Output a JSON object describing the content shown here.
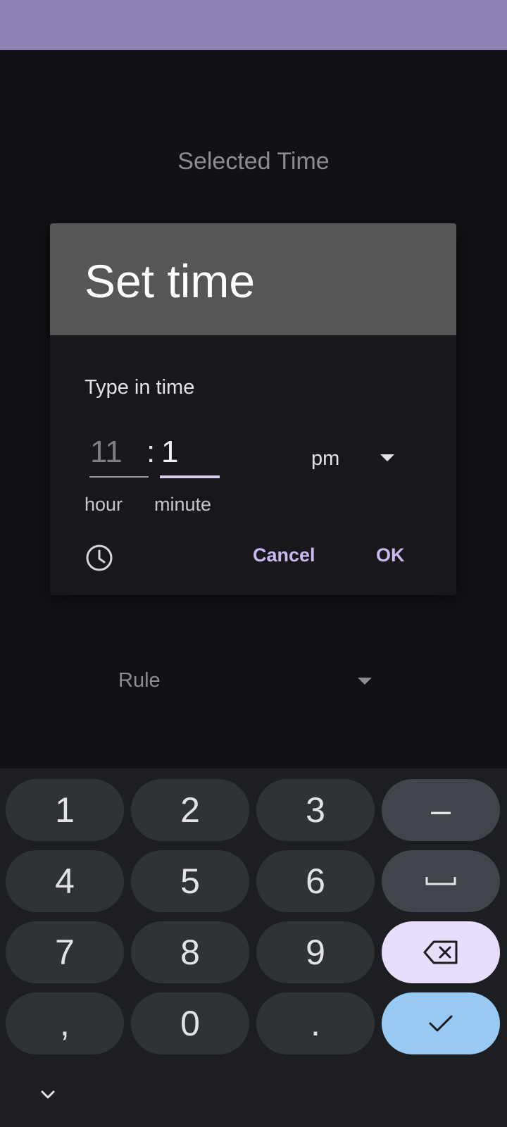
{
  "app": {
    "selected_time_label": "Selected Time",
    "rule_label": "Rule"
  },
  "dialog": {
    "title": "Set time",
    "subtitle": "Type in time",
    "hour_value": "11",
    "separator": ":",
    "minute_value": "1",
    "hour_label": "hour",
    "minute_label": "minute",
    "ampm": "pm",
    "cancel_label": "Cancel",
    "ok_label": "OK",
    "mode_icon": "clock-icon"
  },
  "keyboard": {
    "keys": [
      "1",
      "2",
      "3",
      "–",
      "4",
      "5",
      "6",
      "space",
      "7",
      "8",
      "9",
      "backspace",
      ",",
      "0",
      ".",
      "enter"
    ],
    "labels": {
      "k1": "1",
      "k2": "2",
      "k3": "3",
      "dash": "–",
      "k4": "4",
      "k5": "5",
      "k6": "6",
      "k7": "7",
      "k8": "8",
      "k9": "9",
      "comma": ",",
      "k0": "0",
      "period": "."
    },
    "icons": {
      "space": "space-bar-icon",
      "backspace": "backspace-icon",
      "enter": "checkmark-icon",
      "collapse": "chevron-down-icon"
    }
  },
  "colors": {
    "status_bar": "#8c81b0",
    "accent": "#cbb8ef",
    "backspace_key": "#e8ddfb",
    "enter_key": "#97c9f2"
  }
}
